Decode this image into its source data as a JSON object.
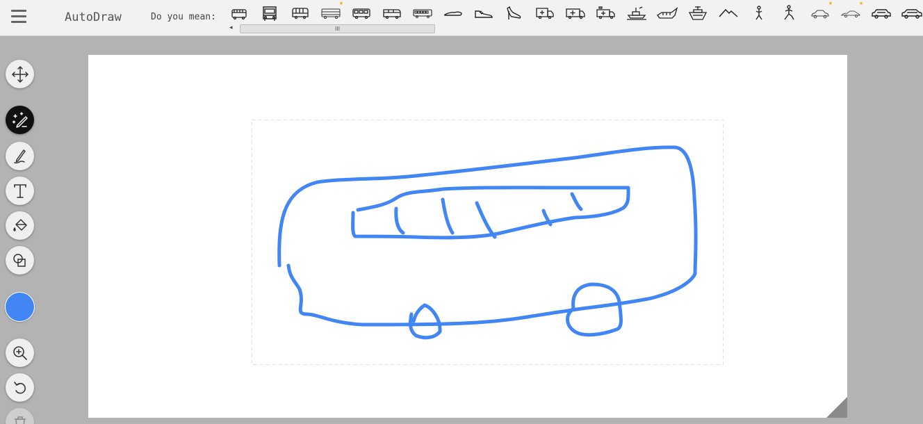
{
  "app": {
    "title": "AutoDraw"
  },
  "suggestions": {
    "label": "Do you mean:",
    "scroll_thumb_glyph": "III",
    "scroll_left_glyph": "◂",
    "items": [
      {
        "icon": "school-bus-front-icon",
        "starred": false
      },
      {
        "icon": "school-bus-icon",
        "starred": false
      },
      {
        "icon": "bus-icon",
        "starred": false
      },
      {
        "icon": "bus-side-icon",
        "starred": true
      },
      {
        "icon": "double-bus-icon",
        "starred": false
      },
      {
        "icon": "van-bus-icon",
        "starred": false
      },
      {
        "icon": "coach-bus-icon",
        "starred": false
      },
      {
        "icon": "flat-shoe-icon",
        "starred": false
      },
      {
        "icon": "sneaker-icon",
        "starred": false
      },
      {
        "icon": "high-heel-icon",
        "starred": false
      },
      {
        "icon": "ambulance-icon",
        "starred": false
      },
      {
        "icon": "ambulance-side-icon",
        "starred": false
      },
      {
        "icon": "ambulance-truck-icon",
        "starred": false
      },
      {
        "icon": "boat-icon",
        "starred": false
      },
      {
        "icon": "ship-icon",
        "starred": false
      },
      {
        "icon": "cruise-ship-icon",
        "starred": false
      },
      {
        "icon": "mountain-icon",
        "starred": false
      },
      {
        "icon": "yoga-pose-icon",
        "starred": false
      },
      {
        "icon": "lunge-pose-icon",
        "starred": false
      },
      {
        "icon": "car-icon",
        "starred": true
      },
      {
        "icon": "sports-car-icon",
        "starred": true
      },
      {
        "icon": "sedan-icon",
        "starred": false
      },
      {
        "icon": "hatchback-icon",
        "starred": false
      }
    ]
  },
  "toolbar": {
    "tools": [
      {
        "name": "move-tool",
        "icon": "move-arrows-icon"
      },
      {
        "name": "autodraw-tool",
        "icon": "magic-pencil-icon",
        "active": true
      },
      {
        "name": "draw-tool",
        "icon": "pencil-icon"
      },
      {
        "name": "type-tool",
        "icon": "text-t-icon"
      },
      {
        "name": "fill-tool",
        "icon": "paint-bucket-icon"
      },
      {
        "name": "shape-tool",
        "icon": "shapes-icon"
      },
      {
        "name": "color-tool",
        "icon": "color-swatch-icon"
      },
      {
        "name": "zoom-tool",
        "icon": "zoom-in-icon"
      },
      {
        "name": "undo-tool",
        "icon": "undo-icon"
      },
      {
        "name": "delete-tool",
        "icon": "trash-icon",
        "disabled": true
      }
    ],
    "selected_color": "#4285f4"
  },
  "canvas": {
    "background": "#ffffff",
    "stroke_color": "#4285f4",
    "selection_border_color": "#e0e0e0"
  }
}
